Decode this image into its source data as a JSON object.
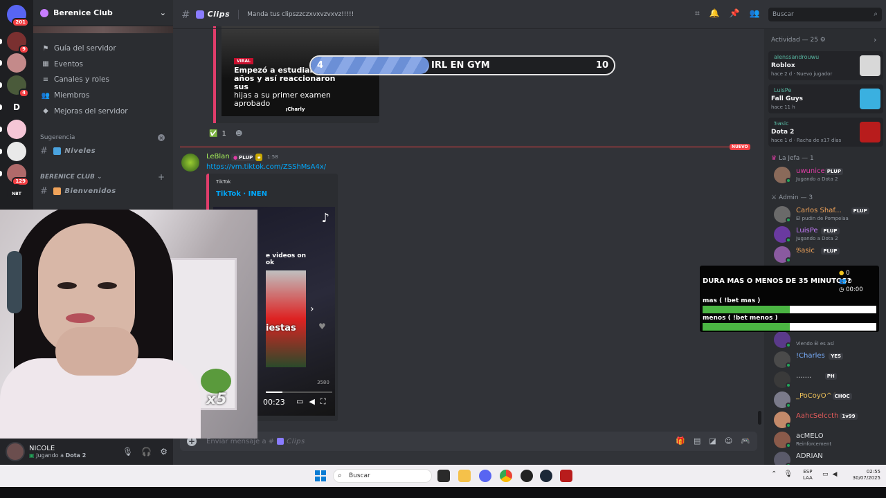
{
  "server": {
    "name": "Berenice Club",
    "rail": [
      {
        "label": "",
        "badge": "201",
        "color": "#5865f2"
      },
      {
        "label": "",
        "badge": "9",
        "color": "#7a3030"
      },
      {
        "label": "",
        "badge": "",
        "color": "#c48a8a"
      },
      {
        "label": "",
        "badge": "4",
        "color": "#4a5a3a"
      },
      {
        "label": "D",
        "badge": "",
        "color": "#1e1f22"
      },
      {
        "label": "",
        "badge": "",
        "color": "#f5c6d6"
      },
      {
        "label": "",
        "badge": "",
        "color": "#e9e9e9"
      },
      {
        "label": "",
        "badge": "129",
        "color": "#b06a6a"
      },
      {
        "label": "NBT",
        "badge": "",
        "color": "#1e1f22"
      }
    ]
  },
  "sidebar": {
    "links": [
      {
        "label": "Guía del servidor",
        "icon": "flag-icon",
        "glyph": "⚑"
      },
      {
        "label": "Eventos",
        "icon": "calendar-icon",
        "glyph": "▦"
      },
      {
        "label": "Canales y roles",
        "icon": "list-icon",
        "glyph": "≡"
      },
      {
        "label": "Miembros",
        "icon": "members-icon",
        "glyph": "👥"
      },
      {
        "label": "Mejoras del servidor",
        "icon": "boost-icon",
        "glyph": "◆"
      }
    ],
    "suggestion_label": "Sugerencia",
    "suggested_channel": "Niveles",
    "category_label": "BERENICE CLUB",
    "category_channel": "Bienvenidos"
  },
  "webcam": {
    "pepe_count": "x5"
  },
  "user_panel": {
    "name": "NICOLE",
    "status_prefix": "Jugando a",
    "status_game": "Dota 2"
  },
  "channel": {
    "name": "Clips",
    "topic": "Manda tus clipszzczxvxvzvxvz!!!!!",
    "search_placeholder": "Buscar"
  },
  "viral_embed": {
    "tag": "VIRAL",
    "text_line1": "Empezó a estudiar a",
    "text_line2": "años y así reaccionaron sus",
    "text_line3": "hijas a su primer examen",
    "text_line4": "aprobado",
    "brand": "¡Charly"
  },
  "reaction": {
    "emoji": "✅",
    "count": "1"
  },
  "new_label": "NUEVO",
  "message": {
    "author": "LeBlan",
    "role_badge": "PLUP",
    "time": "1:58",
    "link": "https://vm.tiktok.com/ZSShMsA4x/",
    "provider": "TikTok",
    "title": "TikTok · INEN",
    "caption_line1": "e videos on",
    "caption_line2": "ok",
    "thumb_text": "iestas",
    "count": "3580",
    "video_time": "00:23",
    "progress": 0.25
  },
  "composer": {
    "placeholder": "Enviar mensaje a #",
    "channel": "Clips"
  },
  "irl_bar": {
    "start": "4",
    "label": "IRL EN GYM",
    "end": "10",
    "progress": 0.39
  },
  "members": {
    "activity_header": "Actividad — 25",
    "activities": [
      {
        "user": "alenssandrouwu",
        "game": "Roblox",
        "meta": "hace 2 d · Nuevo jugador",
        "art": "#d8d8d8"
      },
      {
        "user": "LuisPe",
        "game": "Fall Guys",
        "meta": "hace 11 h",
        "art": "#3ab0e0"
      },
      {
        "user": "𝔅asic",
        "game": "Dota 2",
        "meta": "hace 1 d · Racha de x17 días",
        "art": "#b81c1c"
      }
    ],
    "group1_header": "La Jefa — 1",
    "group1": [
      {
        "name": "uwunice",
        "color": "#e03da6",
        "badge": "PLUP",
        "status": "Jugando a Dota 2",
        "av": "#8a6a5a"
      }
    ],
    "group2_header": "Admin — 3",
    "group2": [
      {
        "name": "Carlos Shaf...",
        "color": "#f0a35a",
        "badge": "PLUP",
        "status": "El pudin de Pompelaa",
        "av": "#6a6a6a"
      },
      {
        "name": "LuisPe",
        "color": "#c77dff",
        "badge": "PLUP",
        "status": "Jugando a Dota 2",
        "av": "#6a3aa0"
      },
      {
        "name": "𝔅asic",
        "color": "#f0a35a",
        "badge": "PLUP",
        "status": "",
        "av": "#8a5aa0"
      }
    ],
    "lower": [
      {
        "name": "",
        "color": "#dbdee1",
        "badge": "",
        "status": "Viendo Él es así",
        "av": "#5a3a8a"
      },
      {
        "name": "!Charles",
        "color": "#7ab0ff",
        "badge": "YES",
        "status": "",
        "av": "#4a4a4a"
      },
      {
        "name": ".......",
        "color": "#dbdee1",
        "badge": "PH",
        "status": "",
        "av": "#3a3a3a"
      },
      {
        "name": "_PoCoyO^^",
        "color": "#f0c35a",
        "badge": "CHOC",
        "status": "",
        "av": "#7a7a8a"
      },
      {
        "name": "AahcSelccth",
        "color": "#e05a5a",
        "badge": "1v99",
        "status": "",
        "av": "#c48a6a"
      },
      {
        "name": "acMELO",
        "color": "#dbdee1",
        "badge": "",
        "status": "Reinforcement",
        "av": "#8a5a4a"
      },
      {
        "name": "ADRIAN",
        "color": "#dbdee1",
        "badge": "",
        "status": "",
        "av": "#5a5a6a"
      }
    ]
  },
  "bet": {
    "question": "DURA MAS O MENOS DE 35 MINUTOS?",
    "coins": "0",
    "voters": "0",
    "timer": "00:00",
    "options": [
      {
        "label": "mas ( !bet mas )",
        "fill": 0.5
      },
      {
        "label": "menos ( !bet menos )",
        "fill": 0.5
      }
    ]
  },
  "taskbar": {
    "search": "Buscar",
    "lang": "ESP",
    "region": "LAA",
    "time": "02:55",
    "date": "30/07/2025"
  },
  "colors": {
    "accent": "#5865f2",
    "link": "#00a8fc",
    "new": "#f23f43",
    "online": "#23a55a",
    "bet_green": "#4bb543"
  }
}
